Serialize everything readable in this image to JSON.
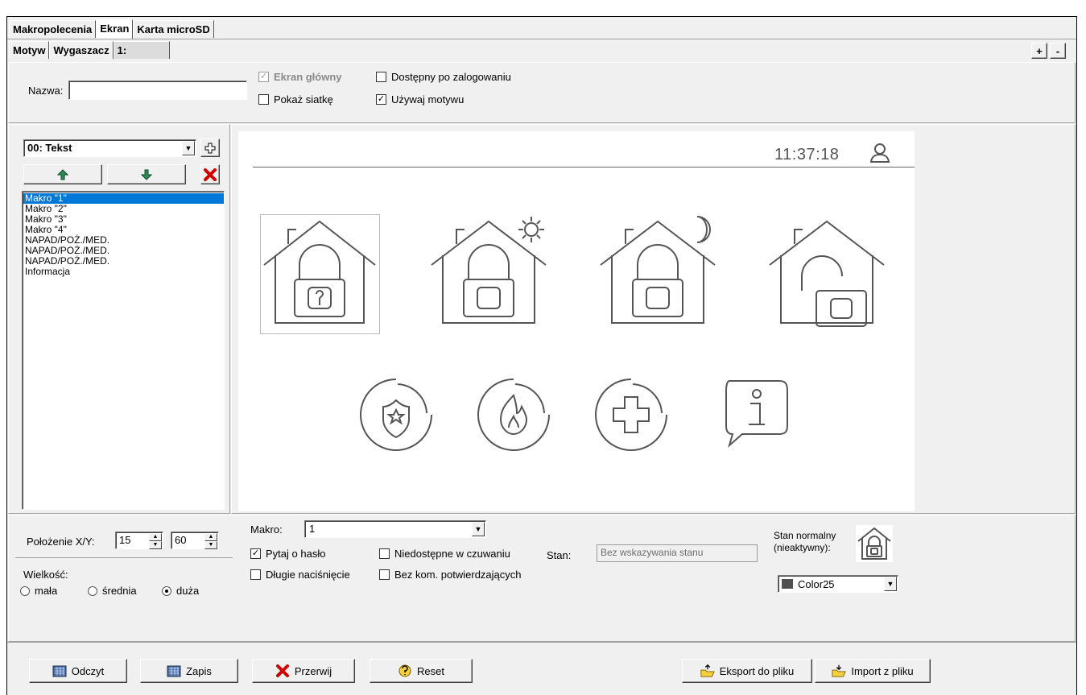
{
  "tabs_top": [
    {
      "label": "Makropolecenia",
      "active": false
    },
    {
      "label": "Ekran",
      "active": true
    },
    {
      "label": "Karta microSD",
      "active": false
    }
  ],
  "tabs_sub": [
    {
      "label": "Motyw",
      "active": false
    },
    {
      "label": "Wygaszacz",
      "active": false
    },
    {
      "label": "1:",
      "active": true
    }
  ],
  "tab_controls": {
    "add": "+",
    "remove": "-"
  },
  "header": {
    "name_label": "Nazwa:",
    "name_value": "",
    "main_screen_label": "Ekran główny",
    "main_screen_checked": true,
    "main_screen_disabled": true,
    "available_after_login_label": "Dostępny po zalogowaniu",
    "available_after_login_checked": false,
    "show_grid_label": "Pokaż siatkę",
    "show_grid_checked": false,
    "use_theme_label": "Używaj motywu",
    "use_theme_checked": true
  },
  "left_panel": {
    "element_select": "00: Tekst",
    "list": [
      "Makro \"1\"",
      "Makro \"2\"",
      "Makro \"3\"",
      "Makro \"4\"",
      "NAPAD/POŻ./MED.",
      "NAPAD/POŻ./MED.",
      "NAPAD/POŻ./MED.",
      "Informacja"
    ],
    "selected_index": 0
  },
  "preview": {
    "time": "11:37:18",
    "icons_row1": [
      "arm-full-icon",
      "arm-day-icon",
      "arm-night-icon",
      "disarmed-icon"
    ],
    "icons_row2": [
      "police-icon",
      "fire-icon",
      "medical-icon",
      "info-icon"
    ]
  },
  "bottom": {
    "position_label": "Położenie X/Y:",
    "pos_x": "15",
    "pos_y": "60",
    "size_label": "Wielkość:",
    "size_options": [
      "mała",
      "średnia",
      "duża"
    ],
    "size_selected": "duża",
    "macro_label": "Makro:",
    "macro_value": "1",
    "ask_password_label": "Pytaj o hasło",
    "ask_password_checked": true,
    "long_press_label": "Długie naciśnięcie",
    "long_press_checked": false,
    "unavailable_armed_label": "Niedostępne w czuwaniu",
    "unavailable_armed_checked": false,
    "no_confirm_label": "Bez kom. potwierdzających",
    "no_confirm_checked": false,
    "state_label": "Stan:",
    "state_value": "Bez wskazywania stanu",
    "normal_state_label_1": "Stan normalny",
    "normal_state_label_2": "(nieaktywny):",
    "color_value": "Color25",
    "color_swatch": "#505050"
  },
  "footer_buttons": {
    "read": "Odczyt",
    "write": "Zapis",
    "abort": "Przerwij",
    "reset": "Reset",
    "export": "Eksport do pliku",
    "import": "Import z pliku"
  },
  "colors": {
    "selection": "#0078d7",
    "icon_stroke": "#555555",
    "delete_red": "#d00000",
    "arrow_green": "#2e8b57"
  }
}
